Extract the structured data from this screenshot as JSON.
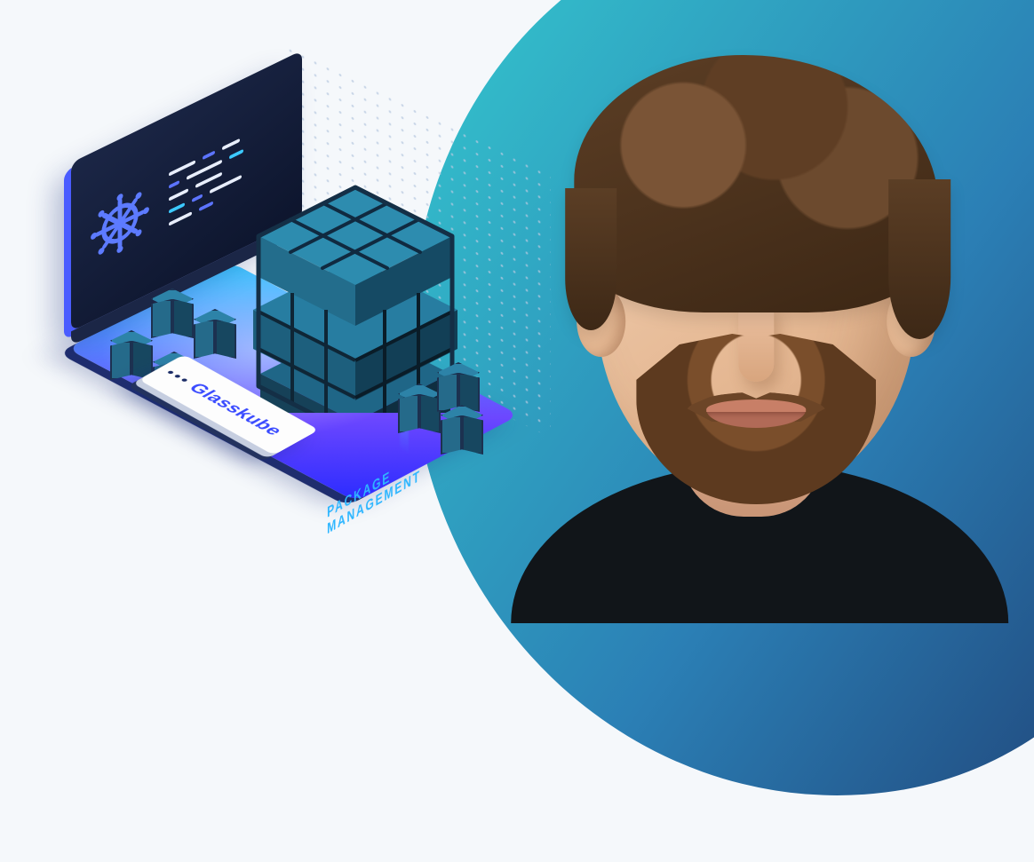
{
  "illustration": {
    "brand": "Glasskube",
    "platform_label_line1": "PACKAGE",
    "platform_label_line2": "MANAGEMENT",
    "monitor_icon": "kubernetes-helm",
    "cube_grid": "3x3x3",
    "satellite_cubes": 7
  },
  "colors": {
    "bg": "#f5f8fb",
    "swoosh_from": "#35cdd0",
    "swoosh_to": "#1e3a6e",
    "platform_from": "#3cc9ff",
    "platform_to": "#2a2bff",
    "monitor": "#1b2646",
    "brand_text": "#3a4bff",
    "cube_top": "#2d83a8",
    "cube_left": "#256a8a",
    "cube_right": "#174760"
  },
  "portrait": {
    "subject": "adult with short brown hair and reddish-brown beard, neutral/curious expression",
    "shirt_color": "#111519"
  }
}
